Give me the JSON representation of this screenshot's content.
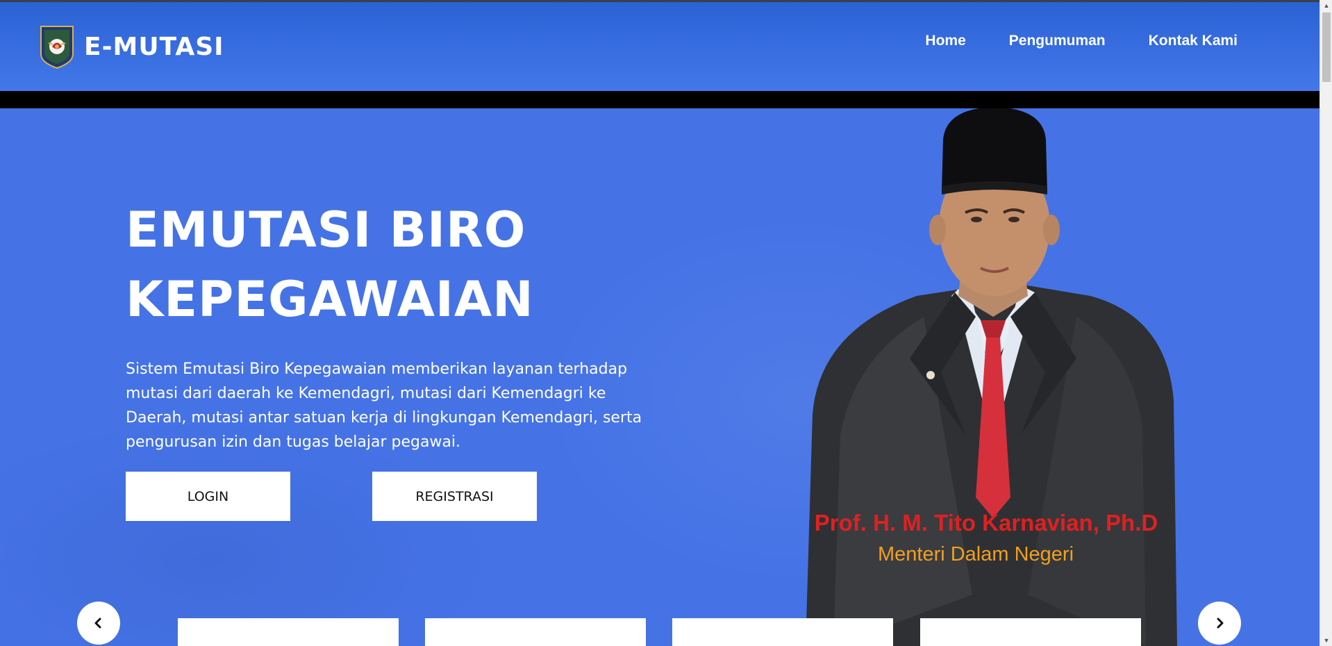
{
  "brand": {
    "name": "E-MUTASI",
    "logo_icon": "kemendagri-emblem-icon"
  },
  "nav": {
    "items": [
      {
        "label": "Home"
      },
      {
        "label": "Pengumuman"
      },
      {
        "label": "Kontak Kami"
      }
    ]
  },
  "hero": {
    "title_line1": "EMUTASI BIRO",
    "title_line2": "KEPEGAWAIAN",
    "description": "Sistem Emutasi Biro Kepegawaian memberikan layanan terhadap mutasi dari daerah ke Kemendagri, mutasi dari Kemendagri ke Daerah, mutasi antar satuan kerja di lingkungan Kemendagri, serta pengurusan izin dan tugas belajar pegawai.",
    "login_label": "LOGIN",
    "register_label": "REGISTRASI"
  },
  "portrait": {
    "name": "Prof. H. M. Tito Karnavian, Ph.D",
    "role": "Menteri Dalam Negeri"
  },
  "carousel": {
    "prev_icon": "chevron-left-icon",
    "next_icon": "chevron-right-icon"
  },
  "colors": {
    "primary": "#4573e6",
    "navbar_top": "#2a62d4",
    "caption_name": "#e02020",
    "caption_role": "#f0a020"
  }
}
